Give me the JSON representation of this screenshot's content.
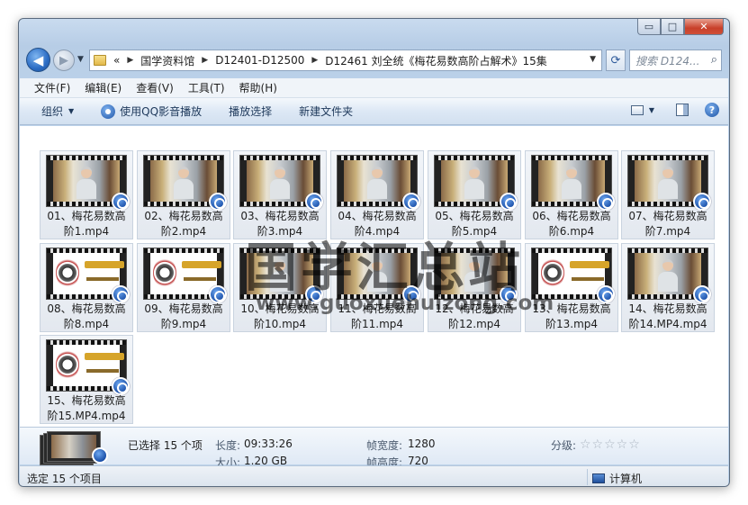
{
  "caption": {
    "minimize": "▭",
    "maximize": "□",
    "close": "✕"
  },
  "address": {
    "crumbs": [
      "«",
      "国学资料馆",
      "D12401-D12500",
      "D12461 刘全统《梅花易数高阶占解术》15集"
    ]
  },
  "search": {
    "placeholder": "搜索 D124..."
  },
  "menu": [
    "文件(F)",
    "编辑(E)",
    "查看(V)",
    "工具(T)",
    "帮助(H)"
  ],
  "commands": {
    "organize": "组织",
    "play_qq": "使用QQ影音播放",
    "play_selection": "播放选择",
    "new_folder": "新建文件夹"
  },
  "files": [
    {
      "name": "01、梅花易数高阶1.mp4",
      "line1": "01、梅花易数高",
      "line2": "阶1.mp4",
      "thumb": "video"
    },
    {
      "name": "02、梅花易数高阶2.mp4",
      "line1": "02、梅花易数高",
      "line2": "阶2.mp4",
      "thumb": "video"
    },
    {
      "name": "03、梅花易数高阶3.mp4",
      "line1": "03、梅花易数高",
      "line2": "阶3.mp4",
      "thumb": "video"
    },
    {
      "name": "04、梅花易数高阶4.mp4",
      "line1": "04、梅花易数高",
      "line2": "阶4.mp4",
      "thumb": "video"
    },
    {
      "name": "05、梅花易数高阶5.mp4",
      "line1": "05、梅花易数高",
      "line2": "阶5.mp4",
      "thumb": "video"
    },
    {
      "name": "06、梅花易数高阶6.mp4",
      "line1": "06、梅花易数高",
      "line2": "阶6.mp4",
      "thumb": "video"
    },
    {
      "name": "07、梅花易数高阶7.mp4",
      "line1": "07、梅花易数高",
      "line2": "阶7.mp4",
      "thumb": "video"
    },
    {
      "name": "08、梅花易数高阶8.mp4",
      "line1": "08、梅花易数高",
      "line2": "阶8.mp4",
      "thumb": "slide"
    },
    {
      "name": "09、梅花易数高阶9.mp4",
      "line1": "09、梅花易数高",
      "line2": "阶9.mp4",
      "thumb": "slide"
    },
    {
      "name": "10、梅花易数高阶10.mp4",
      "line1": "10、梅花易数高",
      "line2": "阶10.mp4",
      "thumb": "video"
    },
    {
      "name": "11、梅花易数高阶11.mp4",
      "line1": "11、梅花易数高",
      "line2": "阶11.mp4",
      "thumb": "video"
    },
    {
      "name": "12、梅花易数高阶12.mp4",
      "line1": "12、梅花易数高",
      "line2": "阶12.mp4",
      "thumb": "video"
    },
    {
      "name": "13、梅花易数高阶13.mp4",
      "line1": "13、梅花易数高",
      "line2": "阶13.mp4",
      "thumb": "slide"
    },
    {
      "name": "14、梅花易数高阶14.MP4.mp4",
      "line1": "14、梅花易数高",
      "line2": "阶14.MP4.mp4",
      "thumb": "video"
    },
    {
      "name": "15、梅花易数高阶15.MP4.mp4",
      "line1": "15、梅花易数高",
      "line2": "阶15.MP4.mp4",
      "thumb": "slide"
    }
  ],
  "watermark": {
    "text": "国学汇总站",
    "url": "www.guoxuehuizong.com"
  },
  "details": {
    "selected": "已选择 15 个项",
    "length_label": "长度:",
    "length_value": "09:33:26",
    "size_label": "大小:",
    "size_value": "1.20 GB",
    "frame_width_label": "帧宽度:",
    "frame_width_value": "1280",
    "frame_height_label": "帧高度:",
    "frame_height_value": "720",
    "rating_label": "分级:",
    "rating_stars": "☆☆☆☆☆"
  },
  "status": {
    "left": "选定 15 个项目",
    "location": "计算机"
  }
}
